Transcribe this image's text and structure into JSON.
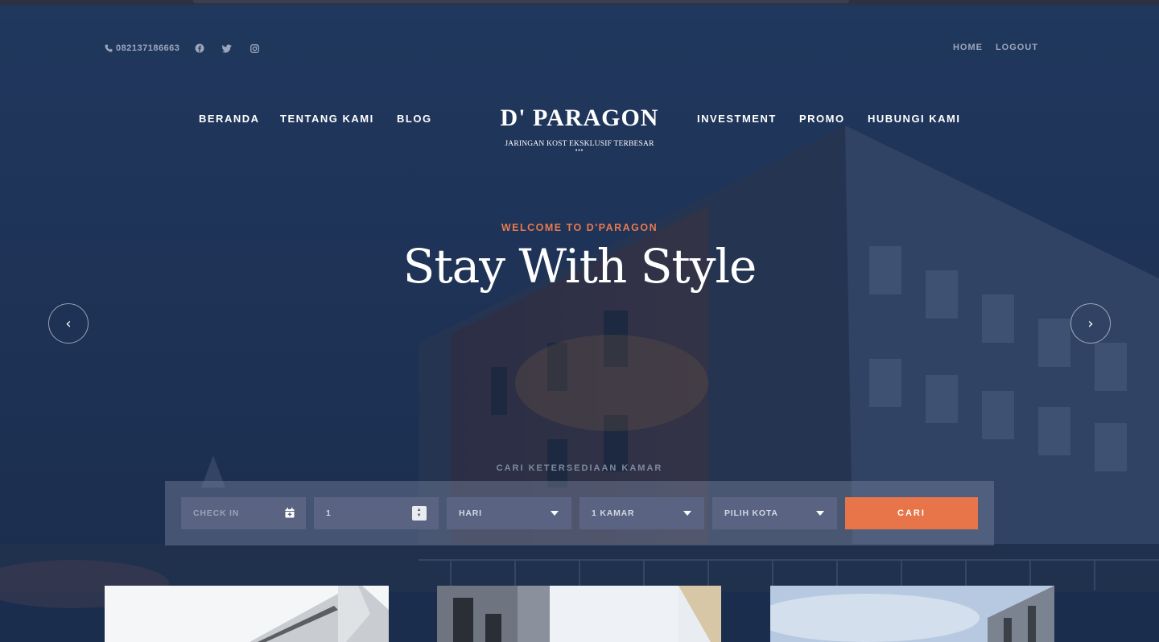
{
  "topbar": {
    "phone": "082137186663",
    "social_icons": [
      "facebook-icon",
      "twitter-icon",
      "instagram-icon"
    ],
    "links": [
      "HOME",
      "LOGOUT"
    ]
  },
  "nav": {
    "left": [
      "BERANDA",
      "TENTANG KAMI",
      "BLOG"
    ],
    "right": [
      "INVESTMENT",
      "PROMO",
      "HUBUNGI KAMI"
    ]
  },
  "logo": {
    "title": "D' PARAGON",
    "subtitle": "JARINGAN KOST EKSKLUSIF TERBESAR",
    "dots": "•••"
  },
  "hero": {
    "welcome": "WELCOME TO D'PARAGON",
    "headline": "Stay With Style",
    "prev_icon": "‹",
    "next_icon": "›"
  },
  "search": {
    "title": "CARI KETERSEDIAAN KAMAR",
    "checkin_placeholder": "CHECK IN",
    "duration_value": "1",
    "unit_select": "HARI",
    "rooms_select": "1 KAMAR",
    "city_select": "PILIH KOTA",
    "submit_label": "CARI"
  },
  "colors": {
    "accent": "#e8754a",
    "hero_bg": "#22375a",
    "field_bg": "#5a6482"
  }
}
